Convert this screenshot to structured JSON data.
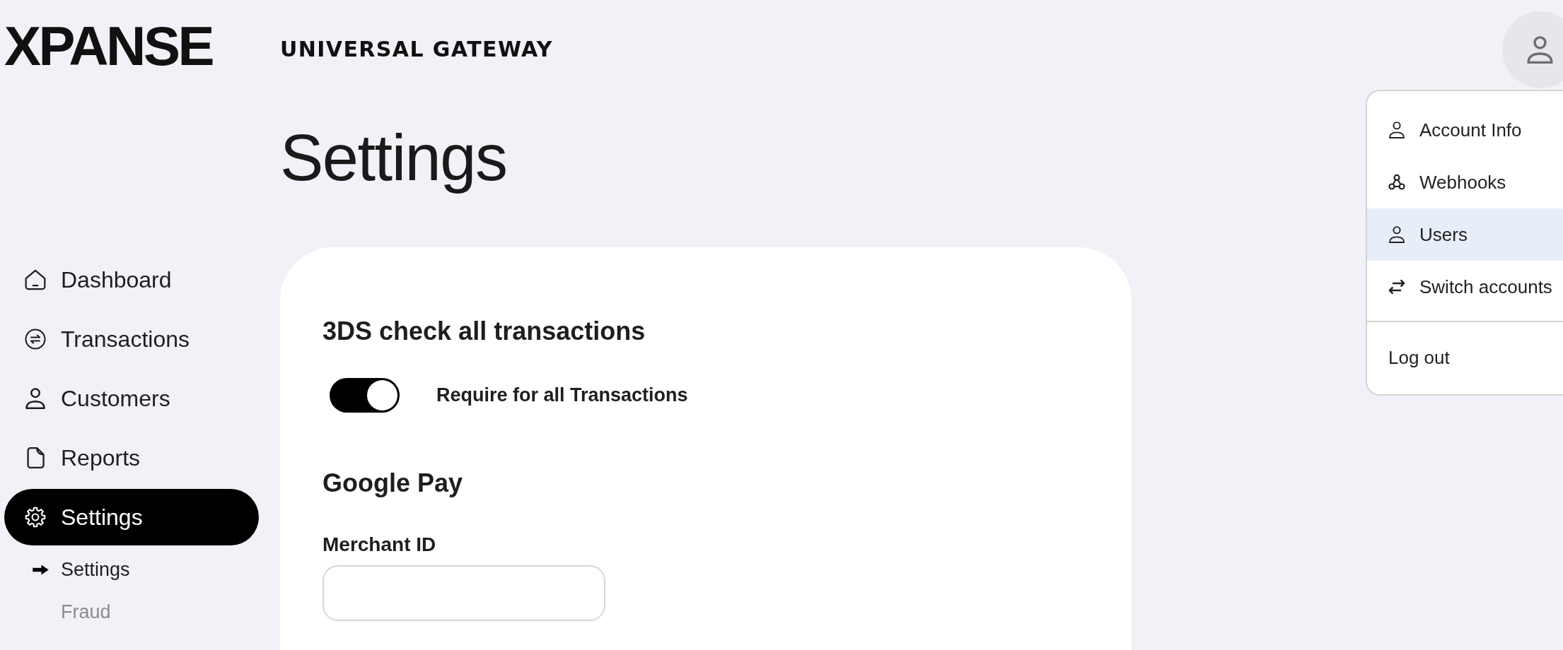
{
  "header": {
    "logo": "XPANSE",
    "product": "UNIVERSAL GATEWAY"
  },
  "account_menu": {
    "items": [
      {
        "label": "Account Info",
        "selected": false
      },
      {
        "label": "Webhooks",
        "selected": false
      },
      {
        "label": "Users",
        "selected": true
      },
      {
        "label": "Switch accounts",
        "selected": false
      }
    ],
    "footer_item": {
      "label": "Log out"
    }
  },
  "sidebar": {
    "items": [
      {
        "label": "Dashboard",
        "selected": false
      },
      {
        "label": "Transactions",
        "selected": false
      },
      {
        "label": "Customers",
        "selected": false
      },
      {
        "label": "Reports",
        "selected": false
      },
      {
        "label": "Settings",
        "selected": true,
        "children": [
          {
            "label": "Settings",
            "selected": true
          },
          {
            "label": "Fraud",
            "selected": false
          }
        ]
      }
    ]
  },
  "page_title": "Settings",
  "sections": [
    {
      "kind": "toggle",
      "title": "3DS check all transactions",
      "toggle": {
        "label": "Require for all Transactions",
        "on": true
      }
    },
    {
      "kind": "field",
      "title": "Google Pay",
      "field": {
        "label": "Merchant ID"
      }
    }
  ]
}
